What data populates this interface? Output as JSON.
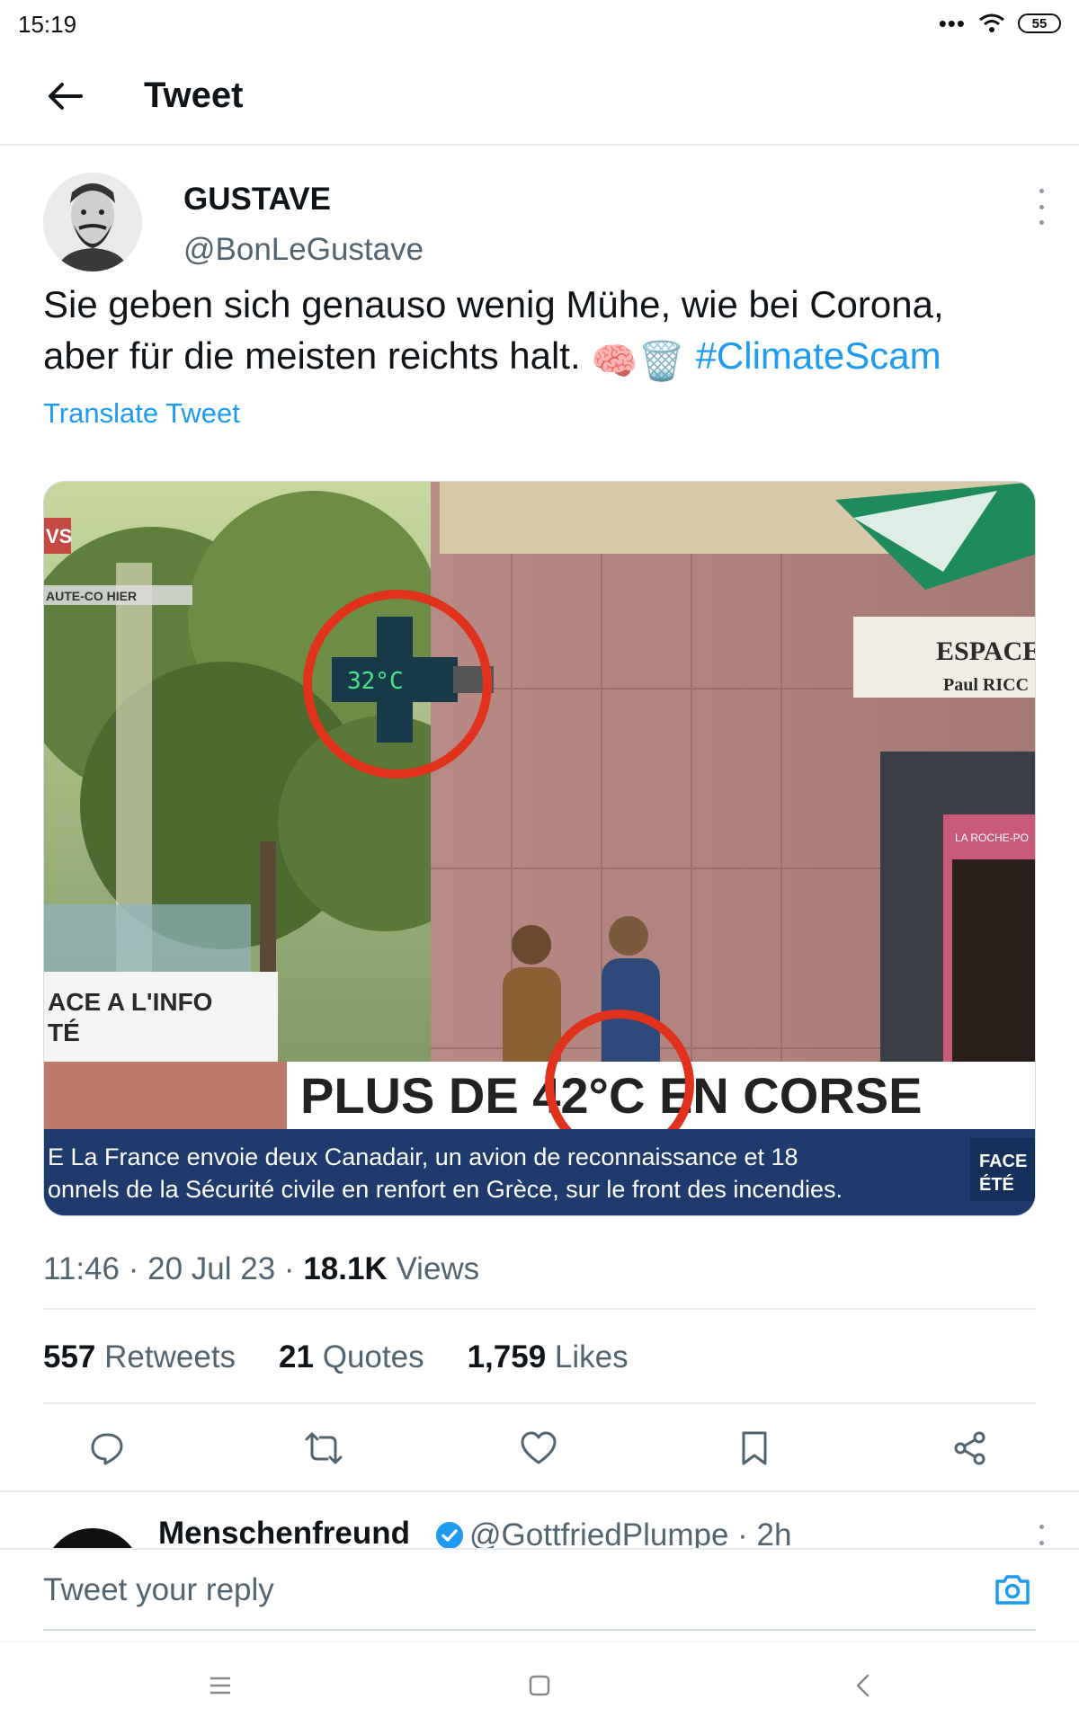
{
  "status_bar": {
    "time": "15:19",
    "battery": "55",
    "overflow": "•••"
  },
  "header": {
    "title": "Tweet"
  },
  "tweet": {
    "display_name": "GUSTAVE",
    "handle": "@BonLeGustave",
    "text_line1": "Sie geben sich genauso wenig Mühe, wie bei Corona,",
    "text_line2": "aber für die meisten reichts halt.",
    "emojis": "🧠🗑️",
    "hashtag": "#ClimateScam",
    "translate_label": "Translate Tweet",
    "image_text": {
      "pharmacy_temp": "32°C",
      "banner_headline": "PLUS DE 42°C EN CORSE",
      "ticker_line1": "E La France envoie deux Canadair, un avion de reconnaissance et 18",
      "ticker_line2": "onnels de la Sécurité civile en renfort en Grèce, sur le front des incendies.",
      "left_panel_line1": "ACE A L'INFO",
      "left_panel_line2": "TÉ",
      "shop_sign_line1": "ESPACE",
      "shop_sign_line2": "Paul RICC",
      "top_left_tag": "VS",
      "top_left_sub": "AUTE-CO   HIER",
      "corner_badge_line1": "FACE",
      "corner_badge_line2": "ÉTÉ",
      "banner_small": "Été",
      "store_brand": "LA ROCHE-PO"
    },
    "time": "11:46",
    "date": "20 Jul 23",
    "views_count": "18.1K",
    "views_label": "Views",
    "sep": "·",
    "retweets_count": "557",
    "retweets_label": "Retweets",
    "quotes_count": "21",
    "quotes_label": "Quotes",
    "likes_count": "1,759",
    "likes_label": "Likes"
  },
  "reply_preview": {
    "name": "Menschenfreund",
    "handle_time": "@GottfriedPlumpe · 2h"
  },
  "composer": {
    "placeholder": "Tweet your reply"
  },
  "colors": {
    "accent": "#1d9bf0",
    "text": "#0f1419",
    "secondary": "#536471",
    "divider": "#e6ecf0"
  },
  "icons": [
    "back-arrow-icon",
    "more-vertical-icon",
    "reply-icon",
    "retweet-icon",
    "like-icon",
    "bookmark-icon",
    "share-icon",
    "verified-icon",
    "camera-icon",
    "menu-icon",
    "home-icon",
    "back-icon"
  ]
}
